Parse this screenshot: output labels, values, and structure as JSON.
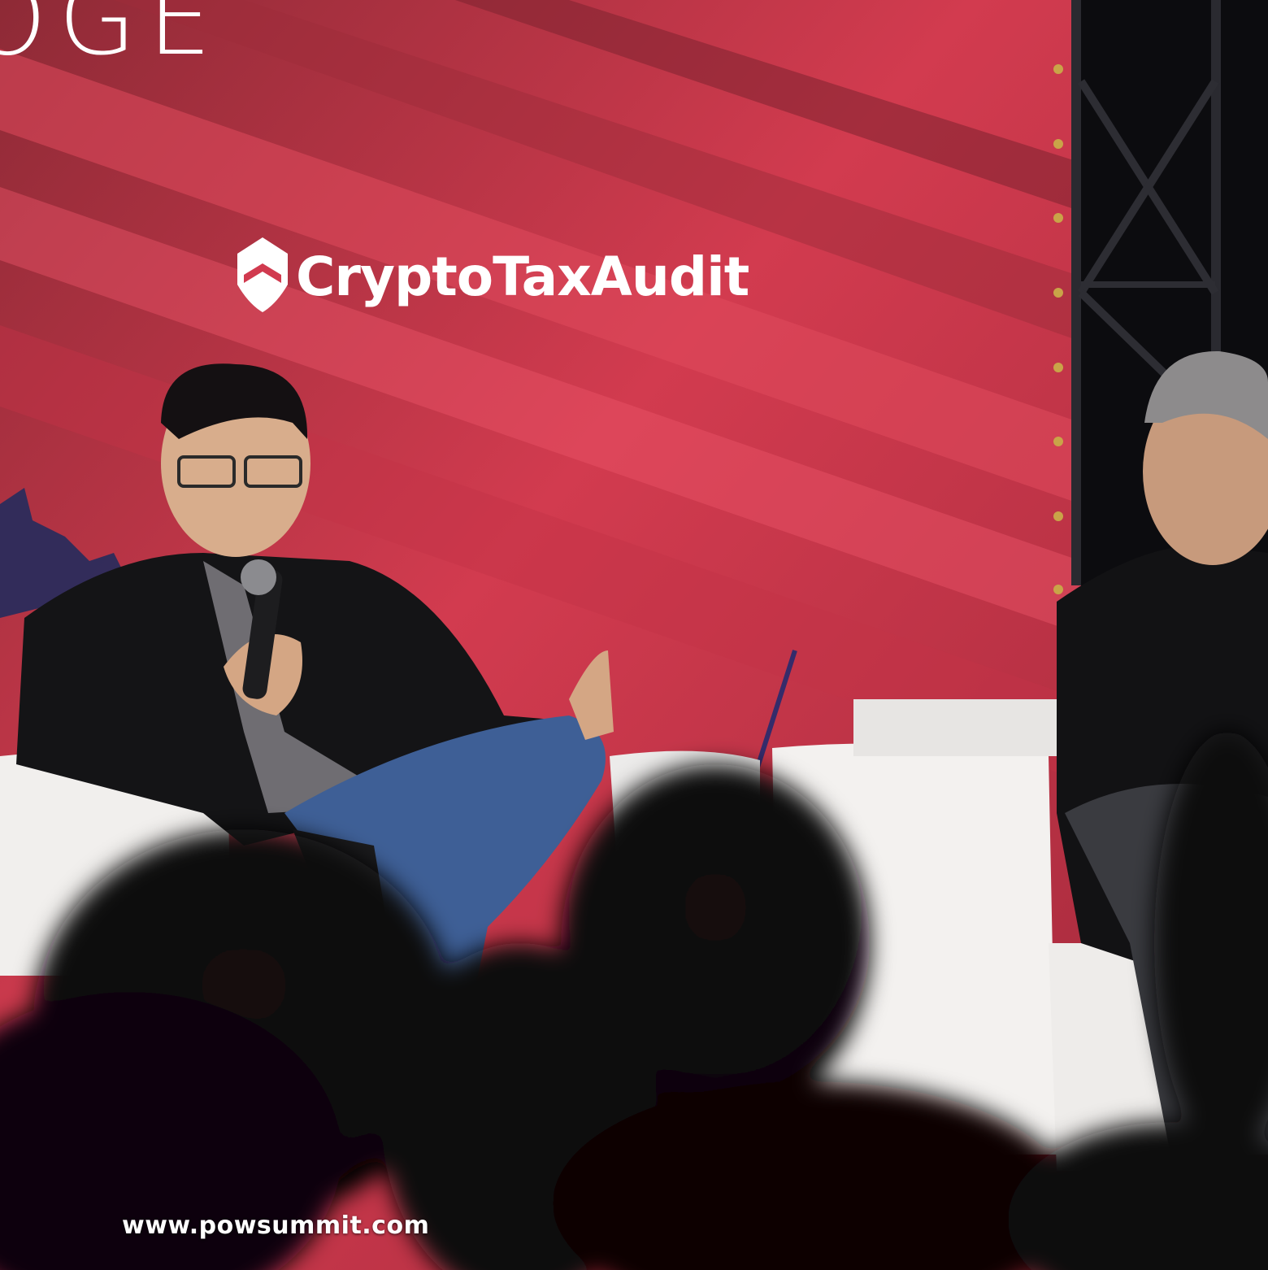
{
  "backdrop": {
    "partial_word": "OGE",
    "sponsor_name": "CryptoTaxAudit",
    "sponsor_logo_icon": "shield-house-icon",
    "colors": {
      "red_light": "#e8485c",
      "red_dark": "#7a1f2e",
      "truss": "#0b0b0d"
    }
  },
  "watermark": {
    "url": "www.powsummit.com"
  }
}
